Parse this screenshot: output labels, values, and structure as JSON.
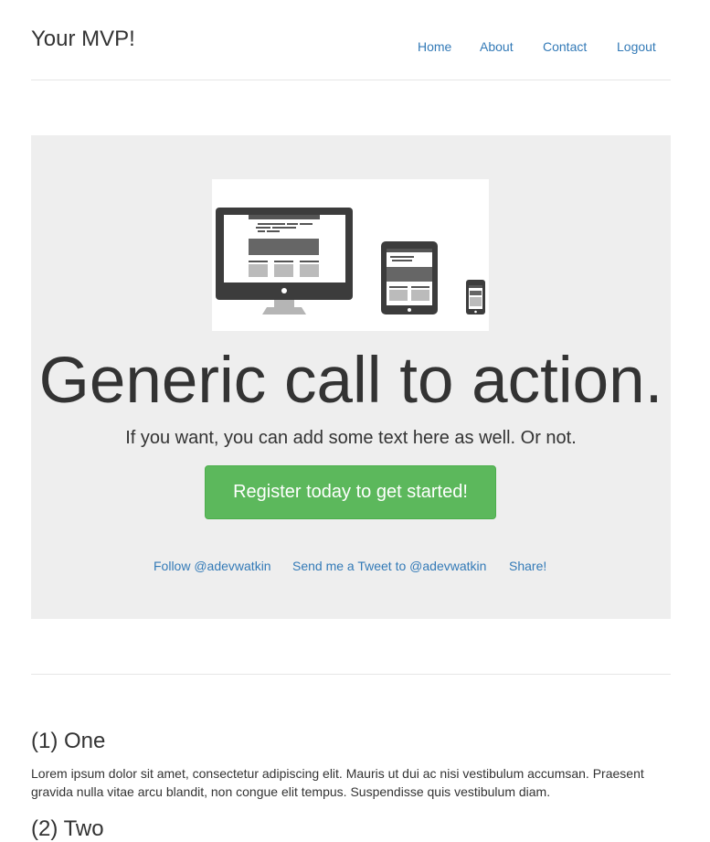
{
  "header": {
    "brand": "Your MVP!",
    "nav": {
      "home": "Home",
      "about": "About",
      "contact": "Contact",
      "logout": "Logout"
    }
  },
  "hero": {
    "image_icon": "responsive-devices-illustration",
    "headline": "Generic call to action.",
    "subline": "If you want, you can add some text here as well. Or not.",
    "cta_label": "Register today to get started!",
    "social": {
      "follow": "Follow @adevwatkin",
      "tweet": "Send me a Tweet to @adevwatkin",
      "share": "Share!"
    }
  },
  "sections": [
    {
      "title": "(1) One",
      "body": "Lorem ipsum dolor sit amet, consectetur adipiscing elit. Mauris ut dui ac nisi vestibulum accumsan. Praesent gravida nulla vitae arcu blandit, non congue elit tempus. Suspendisse quis vestibulum diam."
    },
    {
      "title": "(2) Two"
    }
  ],
  "colors": {
    "link": "#337ab7",
    "cta_bg": "#5cb85c",
    "jumbotron_bg": "#eeeeee",
    "text": "#333333"
  }
}
